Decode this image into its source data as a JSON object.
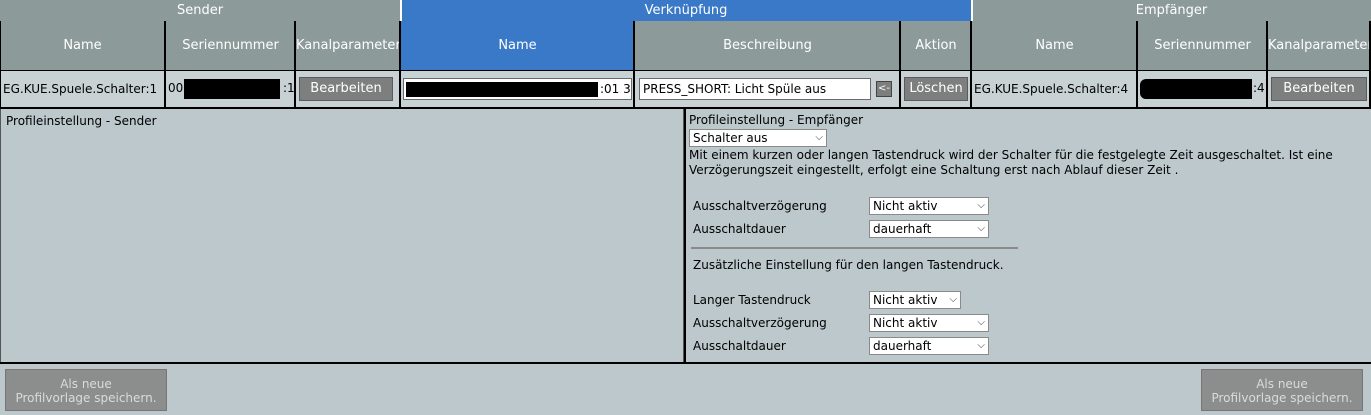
{
  "groups": {
    "sender": "Sender",
    "link": "Verknüpfung",
    "receiver": "Empfänger"
  },
  "columns": {
    "s_name": "Name",
    "s_serial": "Seriennummer",
    "s_params": "Kanalparameter",
    "l_name": "Name",
    "l_desc": "Beschreibung",
    "l_action": "Aktion",
    "r_name": "Name",
    "r_serial": "Seriennummer",
    "r_params": "Kanalparameter"
  },
  "row": {
    "sender_name": "EG.KUE.Spuele.Schalter:1",
    "sender_serial_prefix": "00",
    "sender_serial_suffix": ":1",
    "sender_edit": "Bearbeiten",
    "link_name_suffix": ":01 3",
    "link_desc": "PRESS_SHORT: Licht Spüle aus",
    "link_arrow": "<-",
    "delete": "Löschen",
    "receiver_name": "EG.KUE.Spuele.Schalter:4",
    "receiver_serial_suffix": ":4",
    "receiver_edit": "Bearbeiten"
  },
  "sender_profile": {
    "title": "Profileinstellung - Sender"
  },
  "receiver_profile": {
    "title": "Profileinstellung - Empfänger",
    "profile_select": "Schalter aus",
    "description": "Mit einem kurzen oder langen Tastendruck wird der Schalter für die festgelegte Zeit ausgeschaltet. Ist eine Verzögerungszeit eingestellt, erfolgt eine Schaltung erst nach Ablauf dieser Zeit .",
    "delay_label": "Ausschaltverzögerung",
    "delay_value": "Nicht aktiv",
    "duration_label": "Ausschaltdauer",
    "duration_value": "dauerhaft",
    "long_note": "Zusätzliche Einstellung für den langen Tastendruck.",
    "long_label": "Langer Tastendruck",
    "long_value": "Nicht aktiv",
    "long_delay_label": "Ausschaltverzögerung",
    "long_delay_value": "Nicht aktiv",
    "long_duration_label": "Ausschaltdauer",
    "long_duration_value": "dauerhaft"
  },
  "footer": {
    "save_line1": "Als neue",
    "save_line2": "Profilvorlage speichern."
  }
}
